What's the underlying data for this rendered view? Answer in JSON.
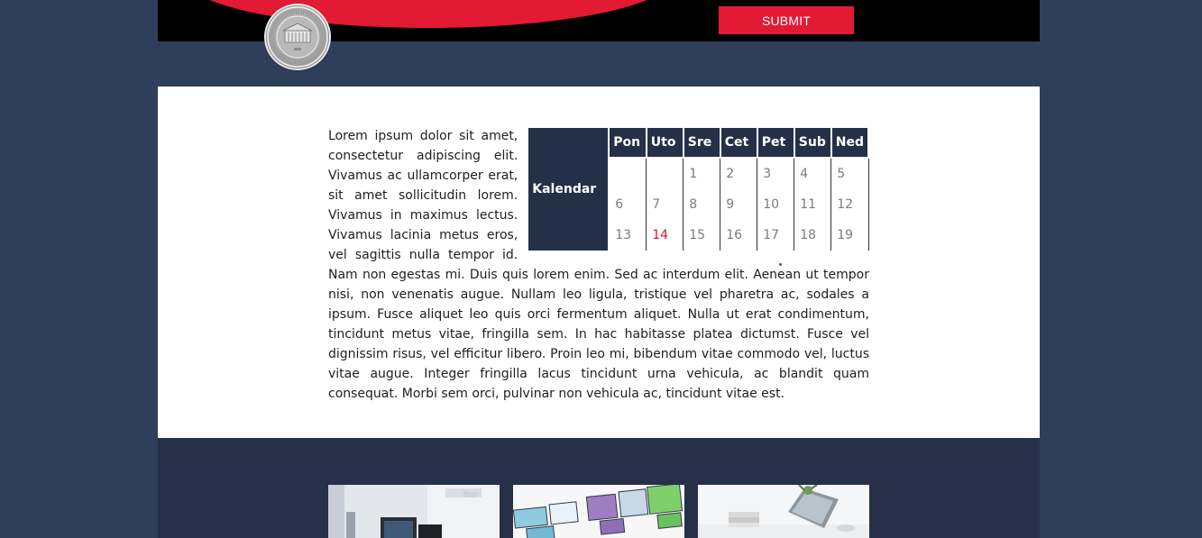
{
  "header": {
    "submit_label": "SUBMIT",
    "logo_icon": "university-seal-logo",
    "brand_colors": {
      "accent": "#e21a34",
      "bar": "#000000",
      "page_bg": "#2f3e5b"
    }
  },
  "content": {
    "article_text": "Lorem ipsum dolor sit amet, consectetur adipiscing elit. Vivamus ac ullamcorper erat, sit amet sollicitudin lorem. Vivamus in maximus lectus. Vivamus lacinia metus eros, vel sagittis nulla tempor id. Nam non egestas mi. Duis quis lorem enim. Sed ac interdum elit. Aenean ut tempor nisi, non venenatis augue. Nullam leo ligula, tristique vel pharetra ac, sodales a ipsum. Fusce aliquet leo quis orci fermentum aliquet. Nulla ut erat condimentum, tincidunt metus vitae, fringilla sem. In hac habitasse platea dictumst. Fusce vel dignissim risus, vel efficitur libero. Proin leo mi, bibendum vitae commodo vel, luctus vitae augue. Integer fringilla lacus tincidunt urna vehicula, ac blandit quam consequat. Morbi sem orci, pulvinar non vehicula ac, tincidunt vitae est.",
    "calendar": {
      "title": "Kalendar",
      "days": [
        "Pon",
        "Uto",
        "Sre",
        "Cet",
        "Pet",
        "Sub",
        "Ned"
      ],
      "weeks": [
        [
          "",
          "",
          "1",
          "2",
          "3",
          "4",
          "5"
        ],
        [
          "6",
          "7",
          "8",
          "9",
          "10",
          "11",
          "12"
        ],
        [
          "13",
          "14",
          "15",
          "16",
          "17",
          "18",
          "19"
        ]
      ],
      "today": "14",
      "today_color": "#d21a2c"
    }
  },
  "gallery": {
    "thumbnails": [
      {
        "icon": "workspace-desk-photo"
      },
      {
        "icon": "sticky-notes-photo"
      },
      {
        "icon": "laptop-desk-photo"
      }
    ]
  }
}
